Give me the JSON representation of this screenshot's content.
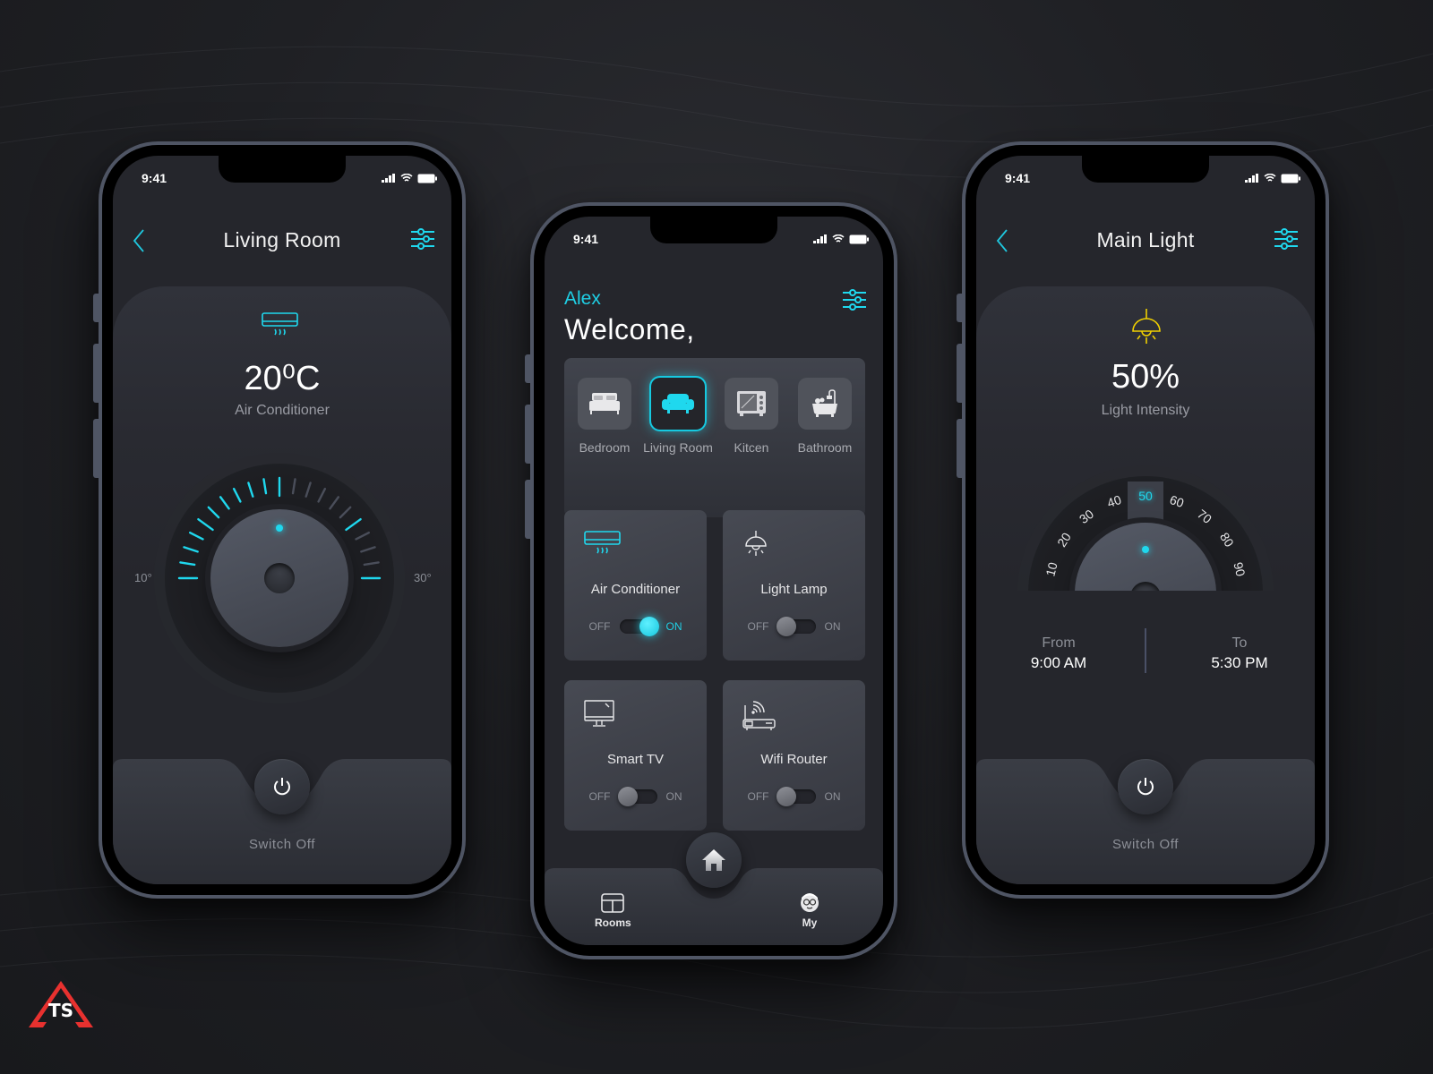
{
  "colors": {
    "accent": "#1fd8ee",
    "light_icon": "#f0d000",
    "logo_red": "#e8312f"
  },
  "status_bar": {
    "time": "9:41"
  },
  "left_phone": {
    "title": "Living Room",
    "back_icon": "chevron-left-icon",
    "settings_icon": "sliders-icon",
    "device_icon": "air-conditioner-icon",
    "temperature": "20⁰C",
    "device_label": "Air Conditioner",
    "min_label": "10°",
    "max_label": "30°",
    "dial": {
      "min": 10,
      "max": 30,
      "value": 20
    },
    "power_label": "Switch Off"
  },
  "middle_phone": {
    "user_name": "Alex",
    "greeting": "Welcome,",
    "rooms": [
      {
        "label": "Bedroom",
        "icon": "bed-icon",
        "active": false
      },
      {
        "label": "Living Room",
        "icon": "sofa-icon",
        "active": true
      },
      {
        "label": "Kitcen",
        "icon": "microwave-icon",
        "active": false
      },
      {
        "label": "Bathroom",
        "icon": "bathtub-icon",
        "active": false
      }
    ],
    "devices": [
      {
        "name": "Air Conditioner",
        "icon": "air-conditioner-icon",
        "state": "on"
      },
      {
        "name": "Light Lamp",
        "icon": "lamp-icon",
        "state": "off"
      },
      {
        "name": "Smart TV",
        "icon": "tv-icon",
        "state": "off"
      },
      {
        "name": "Wifi Router",
        "icon": "router-icon",
        "state": "off"
      }
    ],
    "toggle_off_label": "OFF",
    "toggle_on_label": "ON",
    "tabs": {
      "rooms": "Rooms",
      "home_icon": "home-icon",
      "my": "My"
    }
  },
  "right_phone": {
    "title": "Main Light",
    "intensity": "50%",
    "intensity_label": "Light Intensity",
    "dial_numbers": [
      "10",
      "20",
      "30",
      "40",
      "50",
      "60",
      "70",
      "80",
      "90"
    ],
    "dial_selected": "50",
    "from_label": "From",
    "from_time": "9:00 AM",
    "to_label": "To",
    "to_time": "5:30 PM",
    "power_label": "Switch Off"
  }
}
